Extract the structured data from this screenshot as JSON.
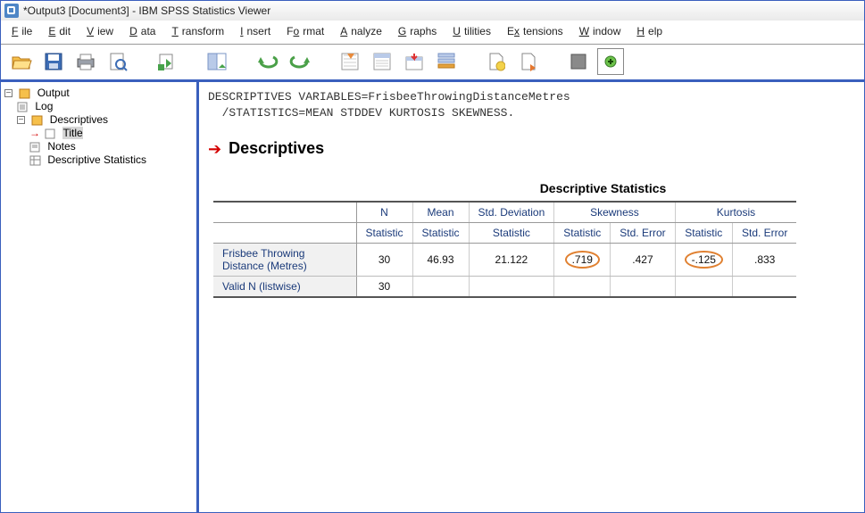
{
  "title": "*Output3 [Document3] - IBM SPSS Statistics Viewer",
  "menu": {
    "file": "ile",
    "edit": "dit",
    "view": "iew",
    "data": "ata",
    "transform": "ransform",
    "insert": "nsert",
    "format": "rmat",
    "analyze": "nalyze",
    "graphs": "raphs",
    "utilities": "tilities",
    "extensions": "tensions",
    "window": "indow",
    "help": "elp"
  },
  "tree": {
    "output": "Output",
    "log": "Log",
    "descriptives": "Descriptives",
    "title": "Title",
    "notes": "Notes",
    "stats": "Descriptive Statistics"
  },
  "syntax": {
    "line1": "DESCRIPTIVES VARIABLES=FrisbeeThrowingDistanceMetres",
    "line2": "/STATISTICS=MEAN STDDEV KURTOSIS SKEWNESS."
  },
  "section": {
    "title": "Descriptives"
  },
  "table": {
    "title": "Descriptive Statistics",
    "cols": {
      "n": "N",
      "mean": "Mean",
      "sd": "Std. Deviation",
      "skew": "Skewness",
      "kurt": "Kurtosis"
    },
    "sub": {
      "stat": "Statistic",
      "se": "Std. Error"
    },
    "rows": [
      {
        "label": "Frisbee Throwing Distance (Metres)",
        "n": "30",
        "mean": "46.93",
        "sd": "21.122",
        "skew_stat": ".719",
        "skew_se": ".427",
        "kurt_stat": "-.125",
        "kurt_se": ".833"
      },
      {
        "label": "Valid N (listwise)",
        "n": "30"
      }
    ]
  }
}
